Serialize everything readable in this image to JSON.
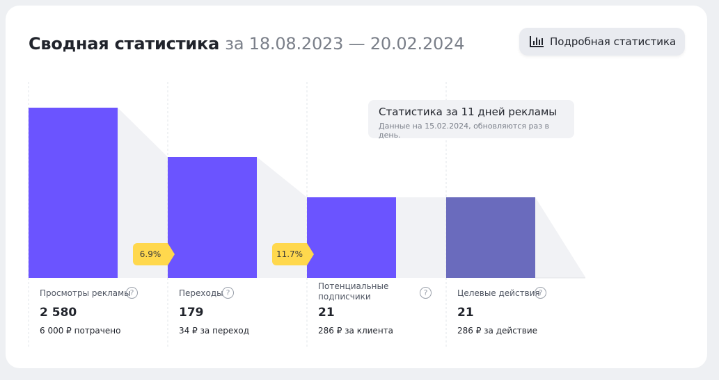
{
  "header": {
    "title": "Сводная статистика",
    "period": "за 18.08.2023 — 20.02.2024",
    "details_button": {
      "label": "Подробная статистика",
      "icon": "bar-chart-icon"
    }
  },
  "tooltip": {
    "title": "Статистика за 11 дней рекламы",
    "note": "Данные на 15.02.2024, обновляются раз в день."
  },
  "colors": {
    "bar_primary": "#6b54ff",
    "bar_muted": "#6a6bbd",
    "badge": "#ffd84d"
  },
  "conversion_badges": [
    "6.9%",
    "11.7%"
  ],
  "metrics": [
    {
      "label": "Просмотры рекламы",
      "value": "2 580",
      "sub": "6 000 ₽ потрачено"
    },
    {
      "label": "Переходы",
      "value": "179",
      "sub": "34 ₽ за переход"
    },
    {
      "label": "Потенциальные подписчики",
      "value": "21",
      "sub": "286 ₽ за клиента"
    },
    {
      "label": "Целевые действия",
      "value": "21",
      "sub": "286 ₽ за действие"
    }
  ]
}
